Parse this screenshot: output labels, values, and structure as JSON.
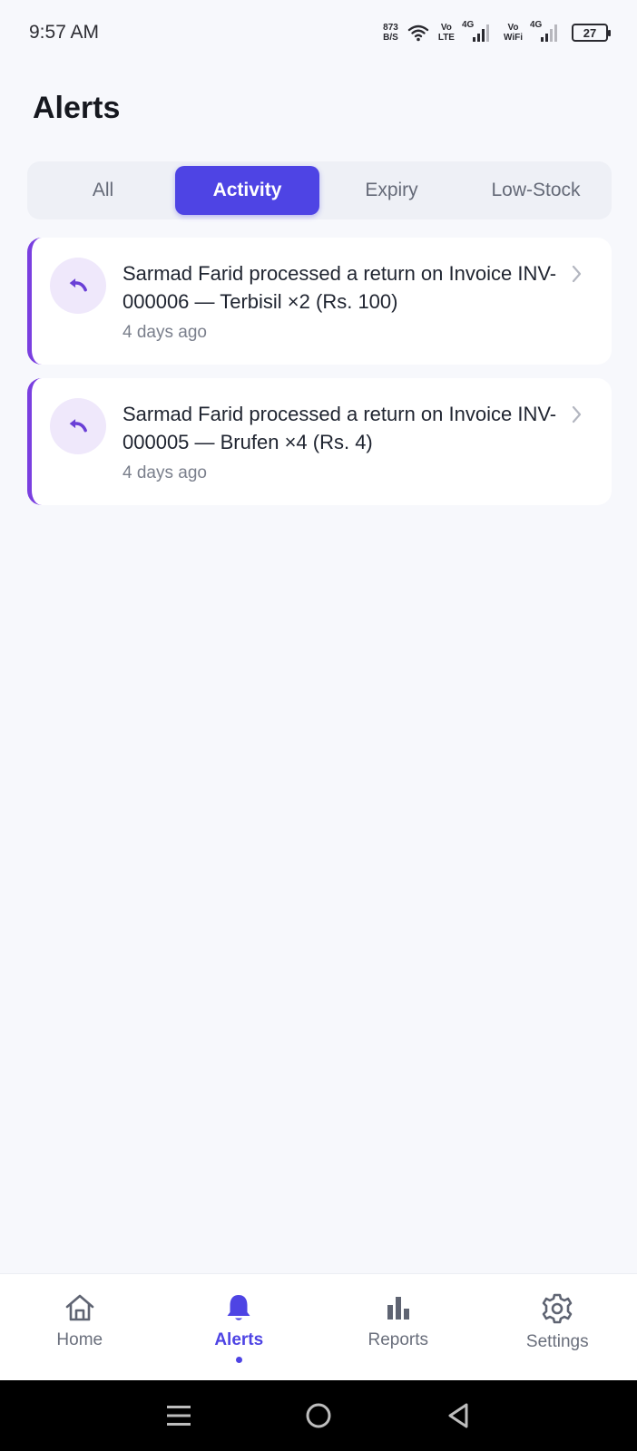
{
  "status_bar": {
    "time": "9:57 AM",
    "net_speed_value": "873",
    "net_speed_unit": "B/S",
    "volte_top": "Vo",
    "volte_bottom": "LTE",
    "net1": "4G",
    "vowifi_top": "Vo",
    "vowifi_bottom": "WiFi",
    "net2": "4G",
    "battery": "27"
  },
  "page": {
    "title": "Alerts"
  },
  "tabs": [
    {
      "label": "All",
      "active": false
    },
    {
      "label": "Activity",
      "active": true
    },
    {
      "label": "Expiry",
      "active": false
    },
    {
      "label": "Low-Stock",
      "active": false
    }
  ],
  "alerts": [
    {
      "icon": "undo-icon",
      "text": "Sarmad Farid processed a return on Invoice INV-000006 — Terbisil ×2 (Rs. 100)",
      "time": "4 days ago"
    },
    {
      "icon": "undo-icon",
      "text": "Sarmad Farid processed a return on Invoice INV-000005 — Brufen ×4 (Rs. 4)",
      "time": "4 days ago"
    }
  ],
  "bottom_nav": [
    {
      "label": "Home",
      "icon": "home-icon",
      "active": false
    },
    {
      "label": "Alerts",
      "icon": "bell-icon",
      "active": true
    },
    {
      "label": "Reports",
      "icon": "bar-chart-icon",
      "active": false
    },
    {
      "label": "Settings",
      "icon": "gear-icon",
      "active": false
    }
  ],
  "colors": {
    "accent": "#4e44e4",
    "alert_border": "#7a3fe0",
    "background": "#f7f8fc"
  }
}
